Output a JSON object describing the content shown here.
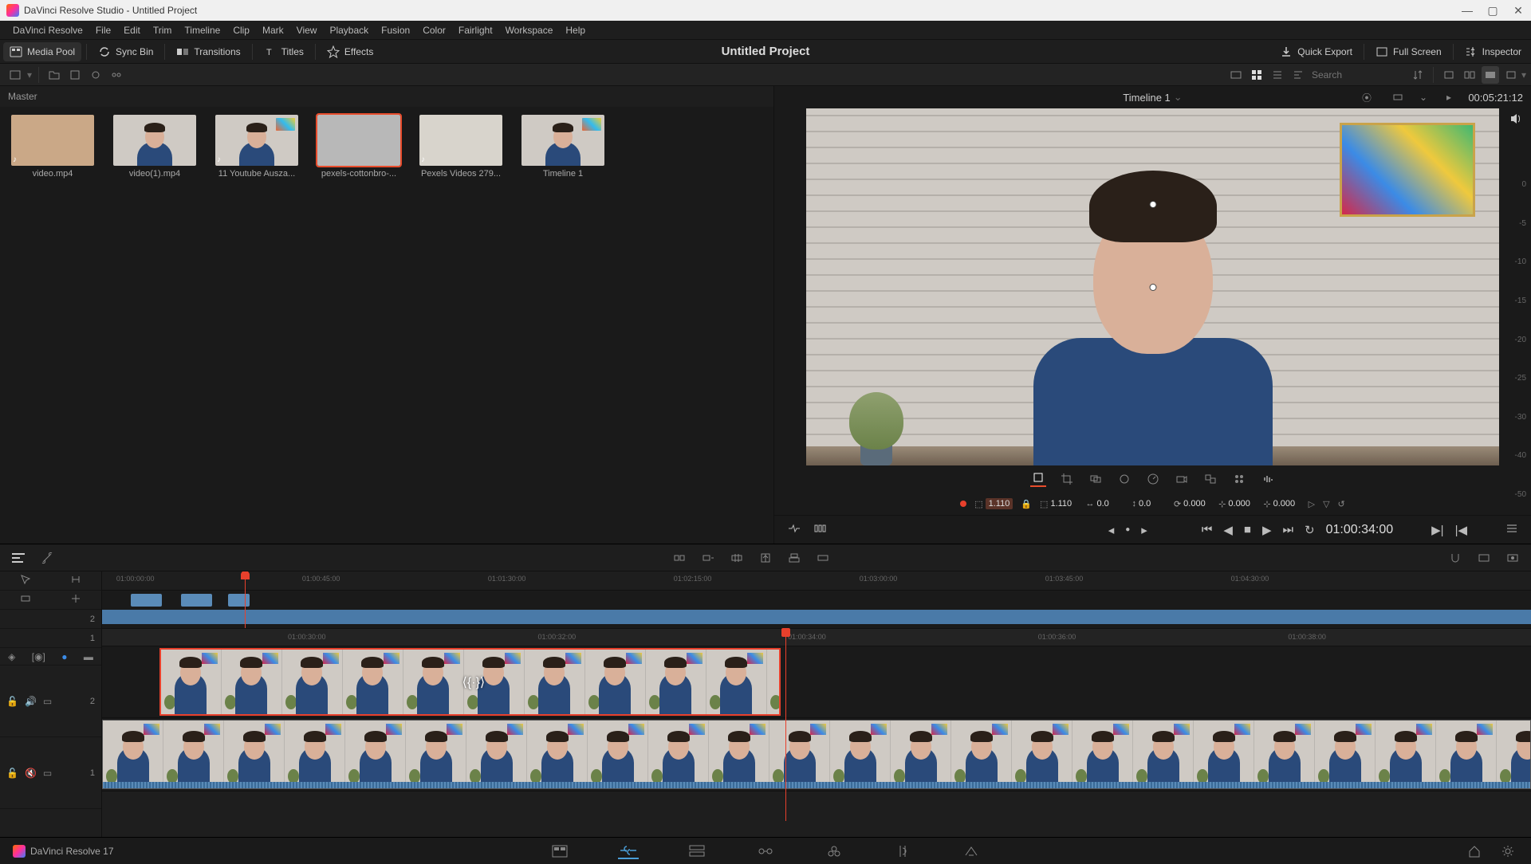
{
  "titlebar": {
    "text": "DaVinci Resolve Studio - Untitled Project"
  },
  "menus": [
    "DaVinci Resolve",
    "File",
    "Edit",
    "Trim",
    "Timeline",
    "Clip",
    "Mark",
    "View",
    "Playback",
    "Fusion",
    "Color",
    "Fairlight",
    "Workspace",
    "Help"
  ],
  "topbar": {
    "media_pool": "Media Pool",
    "sync_bin": "Sync Bin",
    "transitions": "Transitions",
    "titles": "Titles",
    "effects": "Effects",
    "project_title": "Untitled Project",
    "quick_export": "Quick Export",
    "full_screen": "Full Screen",
    "inspector": "Inspector"
  },
  "search": {
    "placeholder": "Search"
  },
  "master_label": "Master",
  "clips": [
    {
      "name": "video.mp4",
      "audio": true,
      "selected": false,
      "pic": false,
      "bg": "#caa887"
    },
    {
      "name": "video(1).mp4",
      "audio": false,
      "selected": false,
      "pic": false,
      "bg": "#cfcac4"
    },
    {
      "name": "11 Youtube Ausza...",
      "audio": true,
      "selected": false,
      "pic": true,
      "bg": "#cfcac4"
    },
    {
      "name": "pexels-cottonbro-...",
      "audio": false,
      "selected": true,
      "pic": false,
      "bg": "#b8b8b8"
    },
    {
      "name": "Pexels Videos 279...",
      "audio": true,
      "selected": false,
      "pic": false,
      "bg": "#d8d4cc"
    },
    {
      "name": "Timeline 1",
      "audio": false,
      "selected": false,
      "pic": true,
      "bg": "#cfcac4"
    }
  ],
  "viewer": {
    "timeline_name": "Timeline 1",
    "timecode": "00:05:21:12"
  },
  "meter_ticks": [
    "0",
    "-5",
    "-10",
    "-15",
    "-20",
    "-25",
    "-30",
    "-40",
    "-50"
  ],
  "transform": {
    "zoom_x": "1.110",
    "zoom_y": "1.110",
    "pos_x": "0.0",
    "pos_y": "0.0",
    "rot": "0.000",
    "anchor_x": "0.000",
    "anchor_y": "0.000"
  },
  "duration": "01:00:34:00",
  "ruler1": [
    {
      "label": "01:00:00:00",
      "left": "1%"
    },
    {
      "label": "01:00:45:00",
      "left": "14%"
    },
    {
      "label": "01:01:30:00",
      "left": "27%"
    },
    {
      "label": "01:02:15:00",
      "left": "40%"
    },
    {
      "label": "01:03:00:00",
      "left": "53%"
    },
    {
      "label": "01:03:45:00",
      "left": "66%"
    },
    {
      "label": "01:04:30:00",
      "left": "79%"
    }
  ],
  "ruler2": [
    {
      "label": "01:00:30:00",
      "left": "13%"
    },
    {
      "label": "01:00:32:00",
      "left": "30.5%"
    },
    {
      "label": "01:00:34:00",
      "left": "48%"
    },
    {
      "label": "01:00:36:00",
      "left": "65.5%"
    },
    {
      "label": "01:00:38:00",
      "left": "83%"
    }
  ],
  "tracks": {
    "v2_num": "2",
    "v1_num": "1",
    "mini2": "2",
    "mini1": "1"
  },
  "app_label": "DaVinci Resolve 17"
}
